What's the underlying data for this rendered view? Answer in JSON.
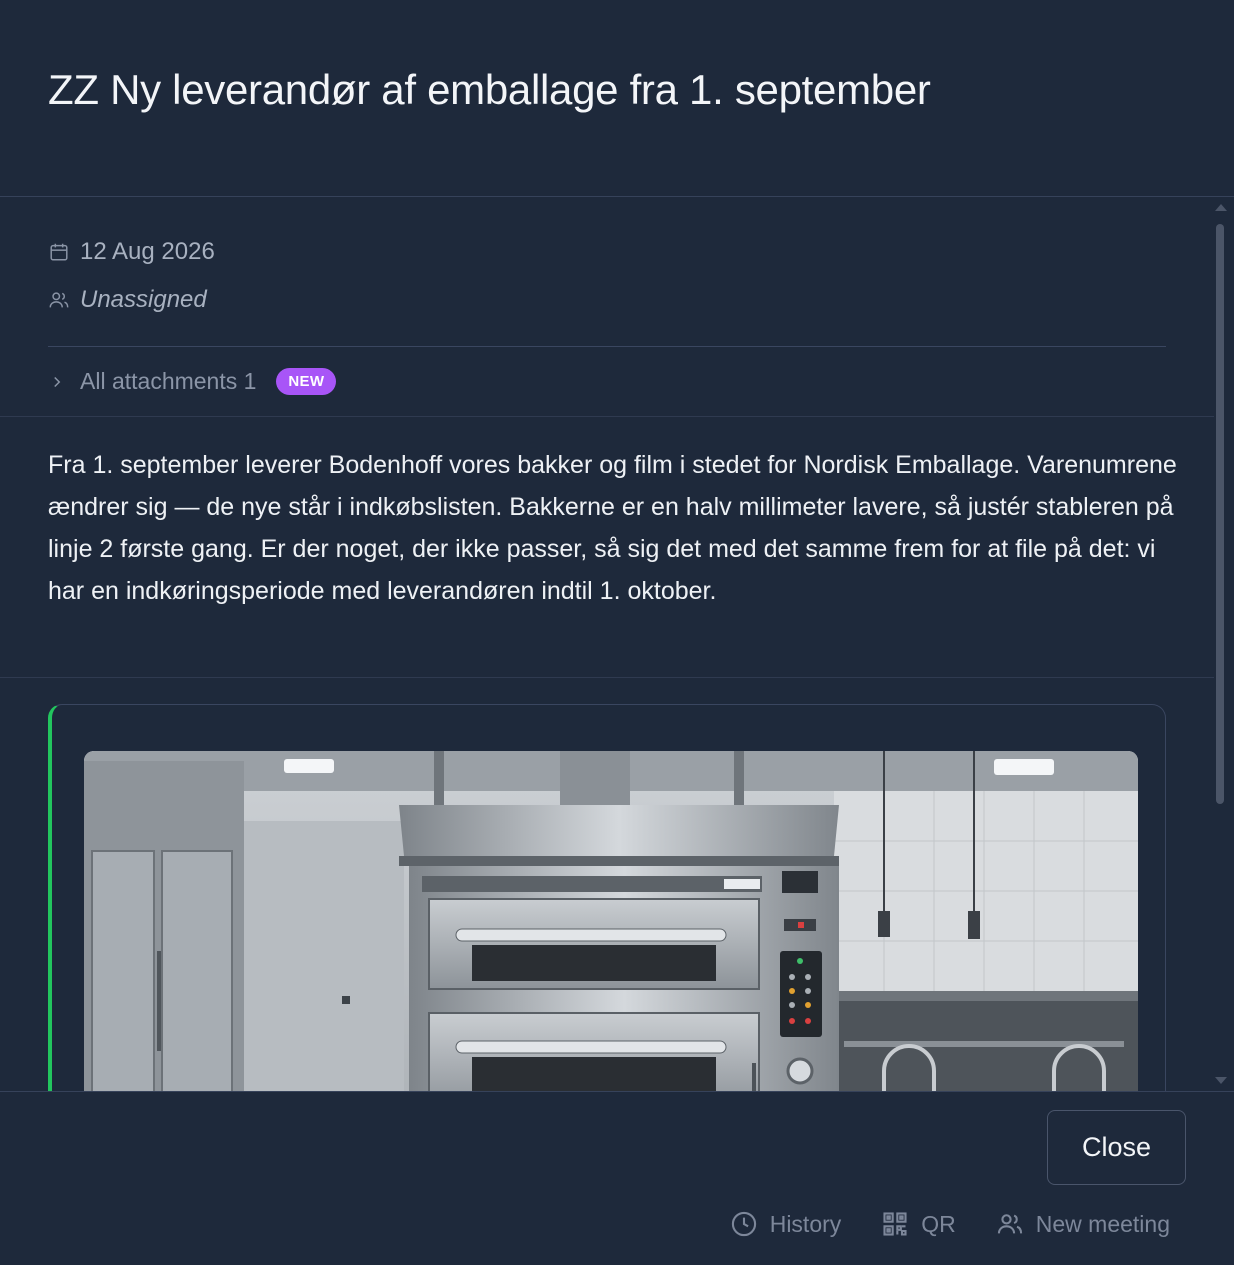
{
  "modal": {
    "title": "ZZ Ny leverandør af emballage fra 1. september"
  },
  "meta": {
    "date": "12 Aug 2026",
    "date_icon": "calendar-icon",
    "assignee": "Unassigned",
    "assignee_icon": "users-icon"
  },
  "attachments": {
    "label": "All attachments 1",
    "badge": "NEW",
    "badge_color": "#a855f7"
  },
  "description": "Fra 1. september leverer Bodenhoff vores bakker og film i stedet for Nordisk Emballage. Varenumrene ændrer sig — de nye står i indkøbslisten. Bakkerne er en halv millimeter lavere, så justér stableren på linje 2 første gang. Er der noget, der ikke passer, så sig det med det samme frem for at file på det: vi har en indkøringsperiode med leverandøren indtil 1. oktober.",
  "card": {
    "accent_color": "#22c55e",
    "image_subject": "commercial kitchen deck oven"
  },
  "footer": {
    "close_label": "Close",
    "actions": [
      {
        "label": "History",
        "icon": "clock-icon"
      },
      {
        "label": "QR",
        "icon": "qr-code-icon"
      },
      {
        "label": "New meeting",
        "icon": "users-icon"
      }
    ]
  }
}
